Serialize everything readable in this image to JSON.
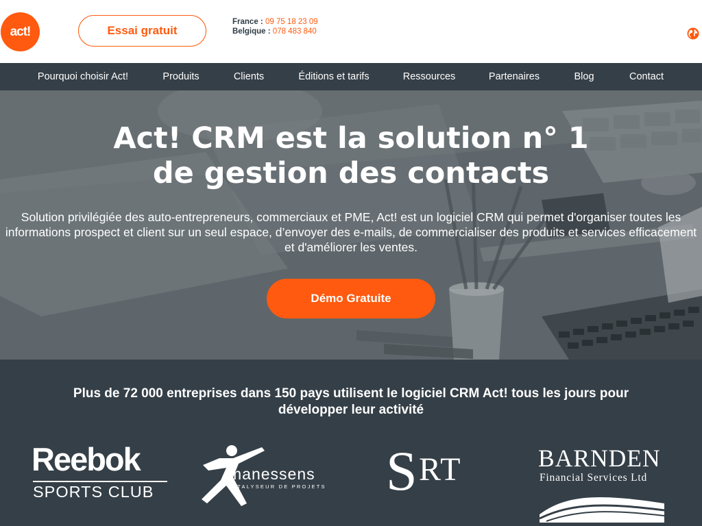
{
  "header": {
    "logo_text": "act!",
    "trial_button": "Essai gratuit",
    "phones": [
      {
        "label": "France :",
        "number": "09 75 18 23 09"
      },
      {
        "label": "Belgique :",
        "number": "078 483 840"
      }
    ],
    "globe_icon": "globe-icon"
  },
  "nav": {
    "items": [
      {
        "label": "Pourquoi choisir Act!"
      },
      {
        "label": "Produits"
      },
      {
        "label": "Clients"
      },
      {
        "label": "Éditions et tarifs"
      },
      {
        "label": "Ressources"
      },
      {
        "label": "Partenaires"
      },
      {
        "label": "Blog"
      },
      {
        "label": "Contact"
      }
    ]
  },
  "hero": {
    "title_line1": "Act! CRM est la solution n° 1",
    "title_line2": "de gestion des contacts",
    "description": "Solution privilégiée des auto-entrepreneurs, commerciaux et PME, Act! est un logiciel CRM qui permet d'organiser toutes les informations prospect et client sur un seul espace, d’envoyer des e-mails, de commercialiser des produits et services efficacement et d'améliorer les ventes.",
    "demo_button": "Démo Gratuite"
  },
  "clients": {
    "title_line1": "Plus de 72 000 entreprises dans 150 pays utilisent le logiciel CRM Act! tous les jours pour",
    "title_line2": "développer leur activité",
    "reebok": {
      "line1": "Reebok",
      "line2": "SPORTS CLUB"
    },
    "manessens": {
      "name": "manessens",
      "tagline": "CATALYSEUR DE PROJETS"
    },
    "srt": {
      "s": "S",
      "rt": "RT"
    },
    "barnden": {
      "line1": "BARNDEN",
      "line2": "Financial Services Ltd"
    }
  },
  "colors": {
    "accent": "#ff5a0f",
    "nav_bg": "#353f47",
    "band_bg": "#353f47",
    "text_dark": "#2f3b45"
  }
}
